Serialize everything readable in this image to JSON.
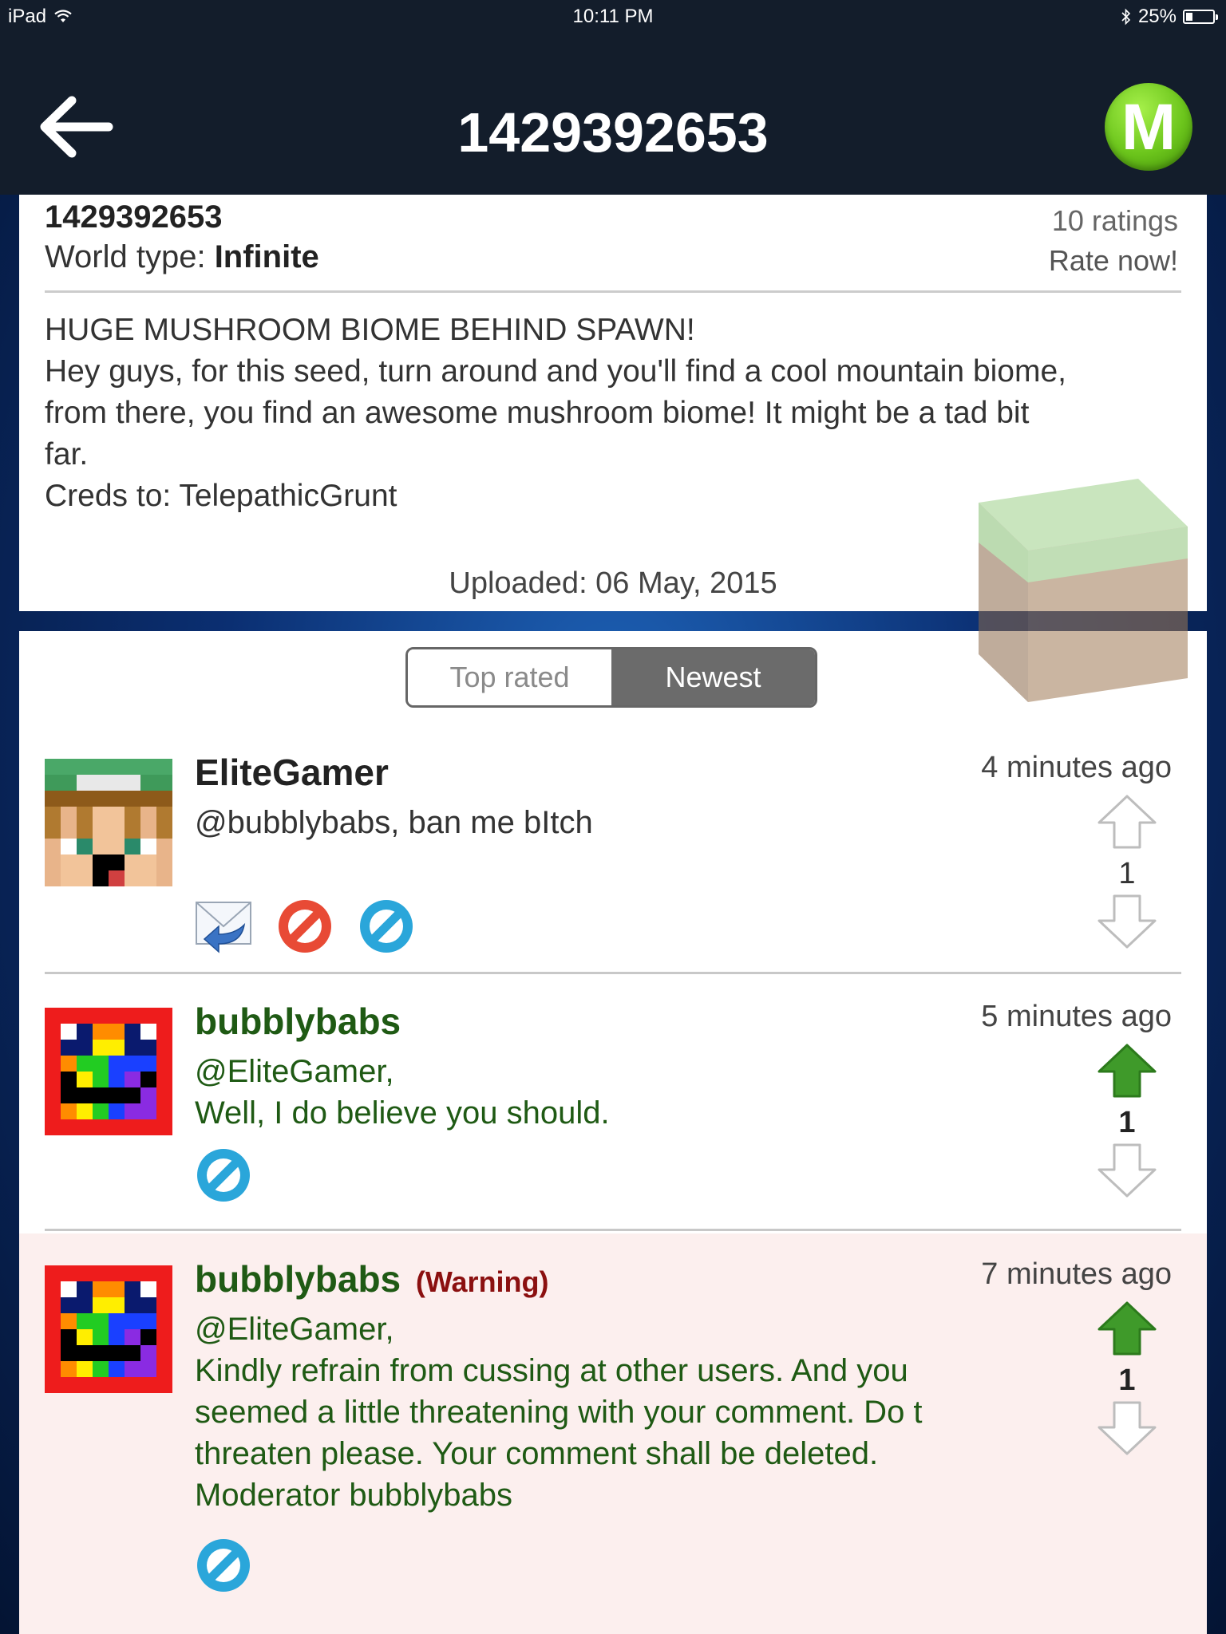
{
  "status_bar": {
    "device": "iPad",
    "time": "10:11 PM",
    "battery": "25%",
    "battery_level": 0.25
  },
  "nav": {
    "title": "1429392653",
    "logo_letter": "M"
  },
  "seed": {
    "seed_number": "1429392653",
    "world_type_label": "World type:",
    "world_type_value": "Infinite",
    "ratings": "10 ratings",
    "rate_now": "Rate now!",
    "description_lines": [
      "HUGE MUSHROOM BIOME BEHIND SPAWN!",
      "Hey guys, for this seed, turn around and you'll find a cool mountain biome,",
      "from there, you find an awesome mushroom biome! It might be a tad bit",
      "far.",
      "Creds to: TelepathicGrunt"
    ],
    "uploaded": "Uploaded: 06 May, 2015"
  },
  "sort_tabs": {
    "top_rated": "Top rated",
    "newest": "Newest",
    "selected": "Newest"
  },
  "comments": [
    {
      "username": "EliteGamer",
      "time": "4 minutes ago",
      "text_lines": [
        "@bubblybabs, ban me bItch"
      ],
      "votes": "1",
      "upvoted": false,
      "actions": [
        "reply-icon",
        "report-icon",
        "block-icon"
      ]
    },
    {
      "username": "bubblybabs",
      "time": "5 minutes ago",
      "text_lines": [
        "@EliteGamer,",
        "Well, I do believe you should."
      ],
      "votes": "1",
      "upvoted": true,
      "actions": [
        "block-icon"
      ]
    },
    {
      "username": "bubblybabs",
      "tag": "(Warning)",
      "time": "7 minutes ago",
      "text_lines": [
        "@EliteGamer,",
        "Kindly refrain from cussing at other users. And you",
        "seemed a little threatening with your comment. Do t",
        "threaten please. Your comment shall be deleted.",
        "Moderator bubblybabs"
      ],
      "votes": "1",
      "upvoted": true,
      "actions": [
        "block-icon"
      ]
    }
  ],
  "colors": {
    "nav_bg": "#131d2b",
    "moderator_text": "#1f5a14",
    "warning_tag": "#8b1010",
    "warning_bg": "#fcefee",
    "upvote_active": "#3f9a2a",
    "logo_green": "#6cc51c"
  }
}
